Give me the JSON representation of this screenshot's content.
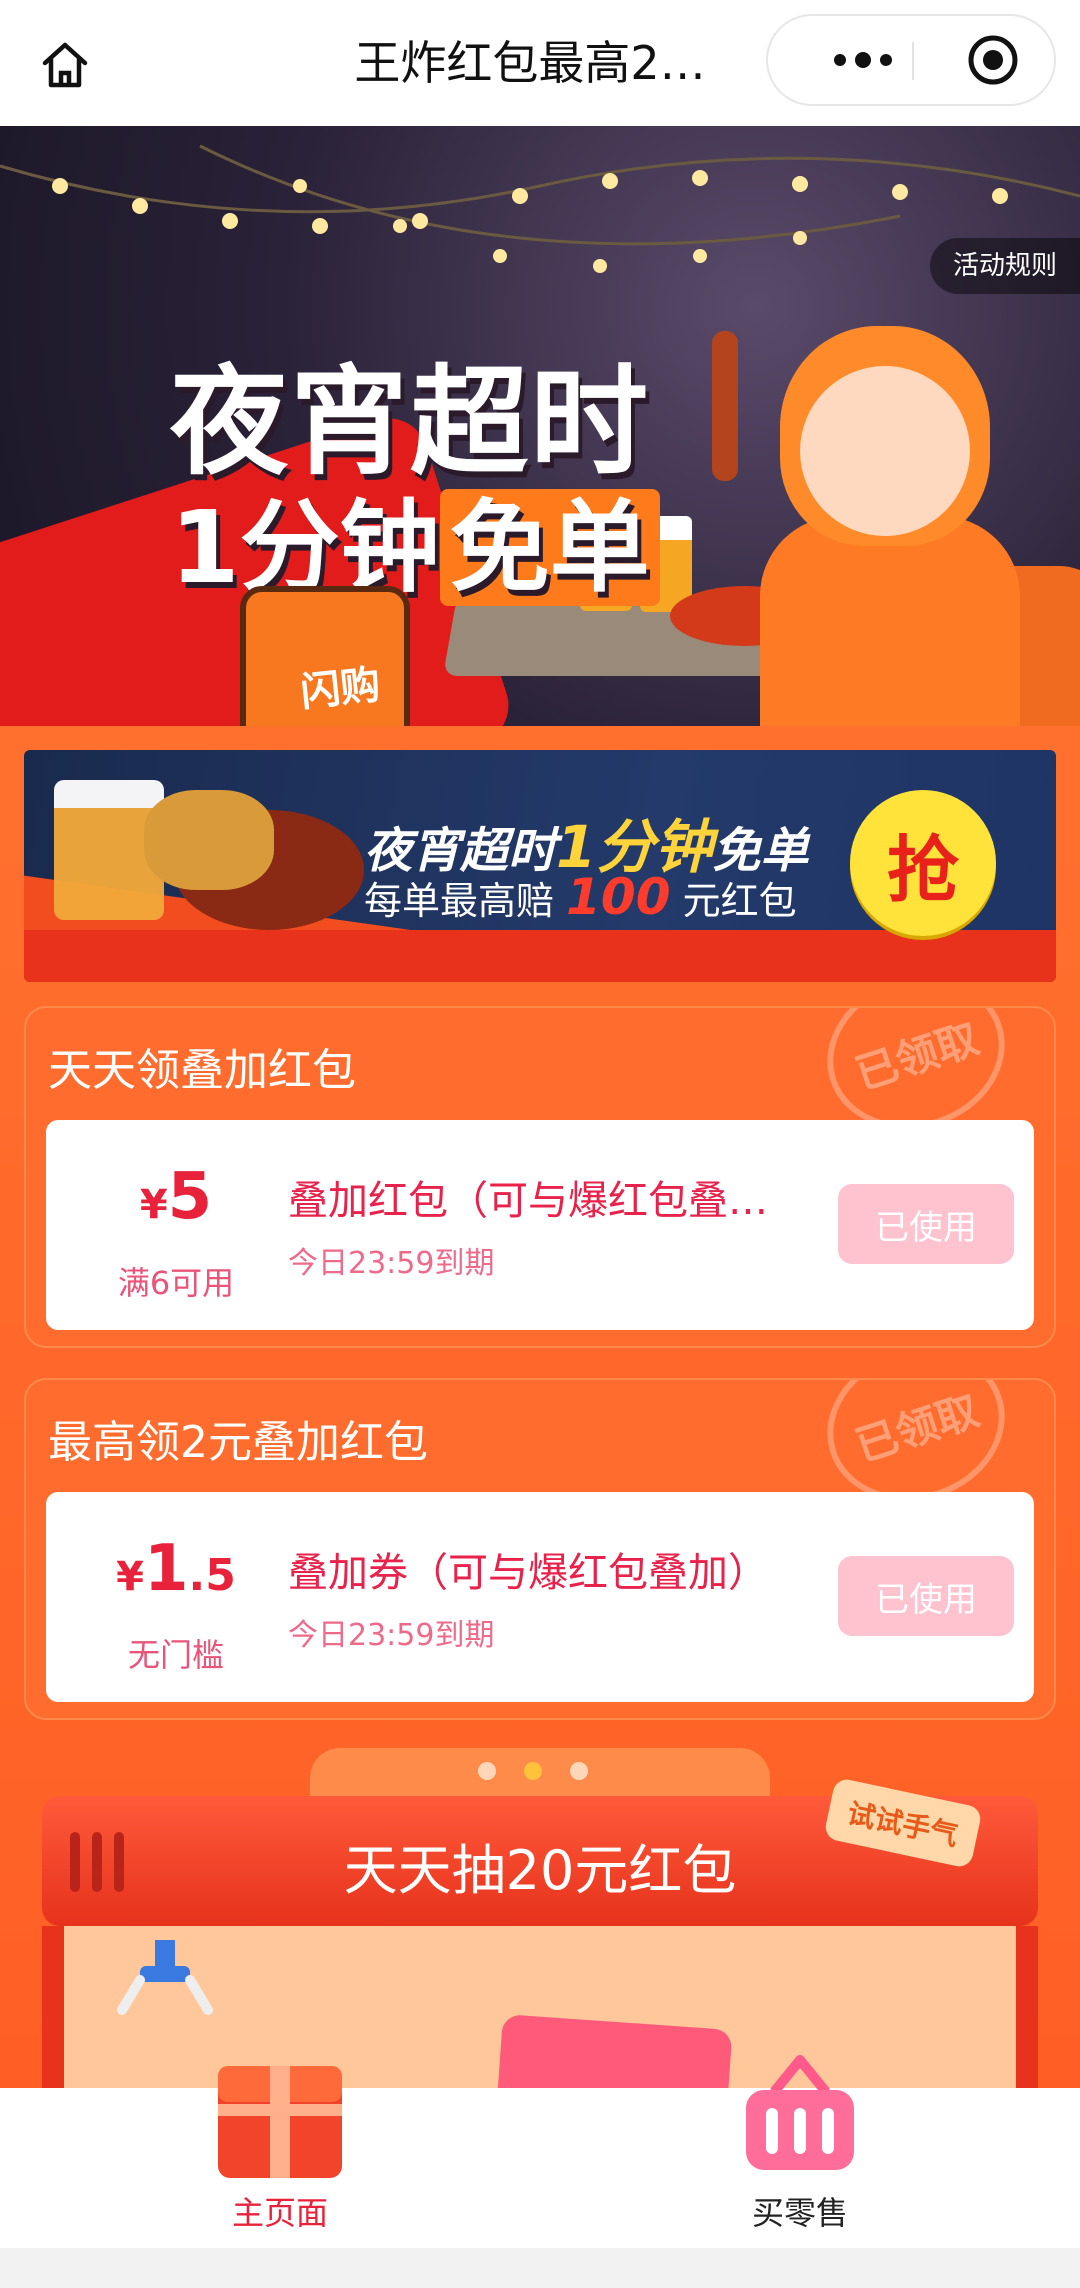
{
  "navbar": {
    "title": "王炸红包最高2…",
    "home_icon": "home-icon",
    "more_icon": "more-dots-icon",
    "close_icon": "target-circle-icon"
  },
  "hero": {
    "headline_line1": "夜宵超时",
    "headline_line2_prefix": "1分钟",
    "headline_line2_highlight": "免单",
    "bag_label": "闪购",
    "rules_button": "活动规则"
  },
  "promo": {
    "line1_prefix": "夜宵超时",
    "line1_highlight": "1分钟",
    "line1_suffix": "免单",
    "line2_prefix": "每单最高赔",
    "line2_amount": "100",
    "line2_suffix": "元红包",
    "grab_button": "抢"
  },
  "sections": [
    {
      "title": "天天领叠加红包",
      "stamp": "已领取",
      "coupon": {
        "currency": "¥",
        "amount_int": "5",
        "amount_dec": "",
        "condition": "满6可用",
        "name": "叠加红包（可与爆红包叠…",
        "expiry": "今日23:59到期",
        "button": "已使用"
      }
    },
    {
      "title": "最高领2元叠加红包",
      "stamp": "已领取",
      "coupon": {
        "currency": "¥",
        "amount_int": "1",
        "amount_dec": ".5",
        "condition": "无门槛",
        "name": "叠加券（可与爆红包叠加）",
        "expiry": "今日23:59到期",
        "button": "已使用"
      }
    }
  ],
  "lottery": {
    "title": "天天抽20元红包",
    "tag": "试试手气"
  },
  "tabbar": {
    "items": [
      {
        "label": "主页面",
        "icon": "gift-box-icon",
        "active": true
      },
      {
        "label": "买零售",
        "icon": "shopping-basket-icon",
        "active": false
      }
    ]
  },
  "colors": {
    "accent": "#ff6a2b",
    "coupon_red": "#e8223a",
    "used_button": "#ffc2cf",
    "grab_yellow": "#ffe23a"
  }
}
